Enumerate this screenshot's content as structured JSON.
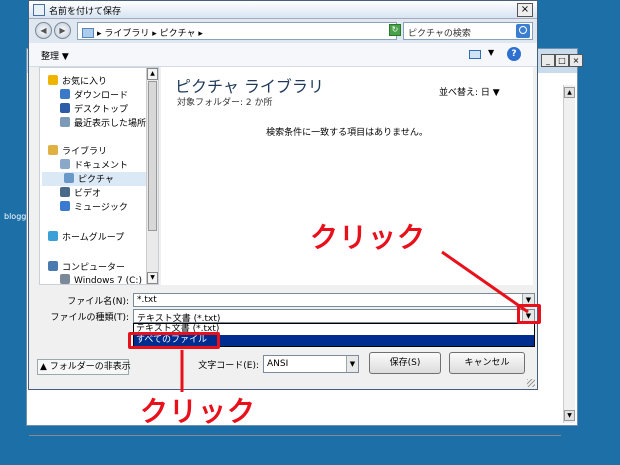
{
  "desktop": {
    "label": "blogg"
  },
  "bg_window": {
    "controls": [
      "_",
      "□",
      "×"
    ]
  },
  "dialog": {
    "title": "名前を付けて保存",
    "close": "×",
    "breadcrumb": "▸ ライブラリ ▸ ピクチャ ▸",
    "search_placeholder": "ピクチャの検索",
    "organize": "整理 ▼",
    "view_arrow": "▼",
    "help": "?",
    "nav_items": [
      {
        "label": "お気に入り",
        "icon": "star-icon",
        "color": "#f0b400"
      },
      {
        "label": "ダウンロード",
        "icon": "download-icon",
        "color": "#3a78c8"
      },
      {
        "label": "デスクトップ",
        "icon": "desktop-icon",
        "color": "#2c5ca8"
      },
      {
        "label": "最近表示した場所",
        "icon": "recent-icon",
        "color": "#7a9ab8"
      },
      {
        "label": "ライブラリ",
        "icon": "library-icon",
        "color": "#e0b040"
      },
      {
        "label": "ドキュメント",
        "icon": "documents-icon",
        "color": "#8aa8c8"
      },
      {
        "label": "ピクチャ",
        "icon": "pictures-icon",
        "color": "#6a98c8"
      },
      {
        "label": "ビデオ",
        "icon": "video-icon",
        "color": "#4a6a8a"
      },
      {
        "label": "ミュージック",
        "icon": "music-icon",
        "color": "#3a7ad0"
      },
      {
        "label": "ホームグループ",
        "icon": "homegroup-icon",
        "color": "#3aa0d8"
      },
      {
        "label": "コンピューター",
        "icon": "computer-icon",
        "color": "#4a7ab0"
      },
      {
        "label": "Windows 7 (C:)",
        "icon": "drive-icon",
        "color": "#7a8a9a"
      }
    ],
    "library_title": "ピクチャ ライブラリ",
    "library_sub": "対象フォルダー: 2 か所",
    "sort_label": "並べ替え: 日 ▼",
    "empty_message": "検索条件に一致する項目はありません。",
    "filename_label": "ファイル名(N):",
    "filename_value": "*.txt",
    "filetype_label": "ファイルの種類(T):",
    "filetype_value": "テキスト文書 (*.txt)",
    "filetype_options": [
      "テキスト文書 (*.txt)",
      "すべてのファイル"
    ],
    "encoding_label": "文字コード(E):",
    "encoding_value": "ANSI",
    "save_label": "保存(S)",
    "cancel_label": "キャンセル",
    "hide_folders_label": "▲ フォルダーの非表示"
  },
  "annotations": {
    "top": "クリック",
    "bottom": "クリック"
  }
}
